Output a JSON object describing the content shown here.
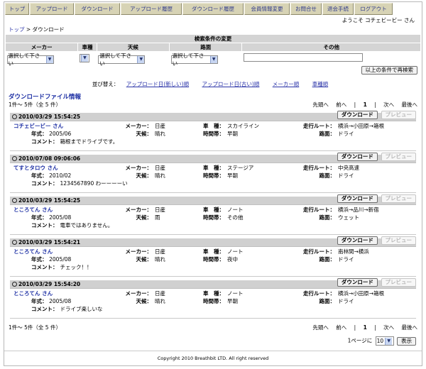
{
  "nav": [
    {
      "label": "トップ",
      "w": 34
    },
    {
      "label": "アップロード",
      "w": 62
    },
    {
      "label": "ダウンロード",
      "w": 64
    },
    {
      "label": "アップロード履歴",
      "w": 86
    },
    {
      "label": "ダウンロード履歴",
      "w": 86
    },
    {
      "label": "会員情報変更",
      "w": 64
    },
    {
      "label": "お問合せ",
      "w": 44
    },
    {
      "label": "退会手続",
      "w": 44
    },
    {
      "label": "ログアウト",
      "w": 54
    }
  ],
  "welcome": "ようこそ コチェビービー さん",
  "breadcrumb": {
    "home": "トップ",
    "sep": ">",
    "current": "ダウンロード"
  },
  "search": {
    "title": "検索条件の変更",
    "cols": [
      "メーカー",
      "車種",
      "天候",
      "路面",
      "その他"
    ],
    "select_default": "選択して下さい",
    "submit": "以上の条件で再検索"
  },
  "sort": {
    "label": "並び替え：",
    "options": [
      "アップロード日(新しい)順",
      "アップロード日(古い)順",
      "メーカー順",
      "車種順"
    ]
  },
  "section_title": "ダウンロードファイル情報",
  "pager": {
    "count": "1件～ 5件（全 5 件）",
    "first": "先頭へ",
    "prev": "前へ",
    "page": "1",
    "next": "次へ",
    "last": "最後へ"
  },
  "labels": {
    "maker": "メーカー：",
    "car": "車　種：",
    "route": "走行ルート：",
    "year": "年式：",
    "weather": "天候：",
    "time": "時間帯：",
    "road": "路面：",
    "comment": "コメント："
  },
  "buttons": {
    "download": "ダウンロード",
    "preview": "プレビュー"
  },
  "records": [
    {
      "ts": "2010/03/29 15:54:25",
      "user": "コチェビービー さん",
      "maker": "日産",
      "car": "スカイライン",
      "route": "横浜→小田原→箱根",
      "year": "2005/06",
      "weather": "晴れ",
      "time": "早朝",
      "road": "ドライ",
      "comment": "箱根までドライブです。"
    },
    {
      "ts": "2010/07/08 09:06:06",
      "user": "てすとタロウ さん",
      "maker": "日産",
      "car": "ステージア",
      "route": "中央高速",
      "year": "2010/02",
      "weather": "晴れ",
      "time": "早朝",
      "road": "ドライ",
      "comment": "1234567890 わーーーーい"
    },
    {
      "ts": "2010/03/29 15:54:25",
      "user": "ところてん さん",
      "maker": "日産",
      "car": "ノート",
      "route": "横浜→品川→新宿",
      "year": "2005/08",
      "weather": "雨",
      "time": "その他",
      "road": "ウェット",
      "comment": "電車ではありません。"
    },
    {
      "ts": "2010/03/29 15:54:21",
      "user": "ところてん さん",
      "maker": "日産",
      "car": "ノート",
      "route": "南林間→横浜",
      "year": "2005/08",
      "weather": "晴れ",
      "time": "夜中",
      "road": "ドライ",
      "comment": "チェック！！"
    },
    {
      "ts": "2010/03/29 15:54:20",
      "user": "ところてん さん",
      "maker": "日産",
      "car": "ノート",
      "route": "横浜→小田原→箱根",
      "year": "2005/08",
      "weather": "晴れ",
      "time": "早朝",
      "road": "ドライ",
      "comment": "ドライブ楽しいな"
    }
  ],
  "perpage": {
    "label": "1ページに",
    "value": "10",
    "button": "表示"
  },
  "copyright": "Copyright 2010 Breathbit LTD. All right reserved"
}
